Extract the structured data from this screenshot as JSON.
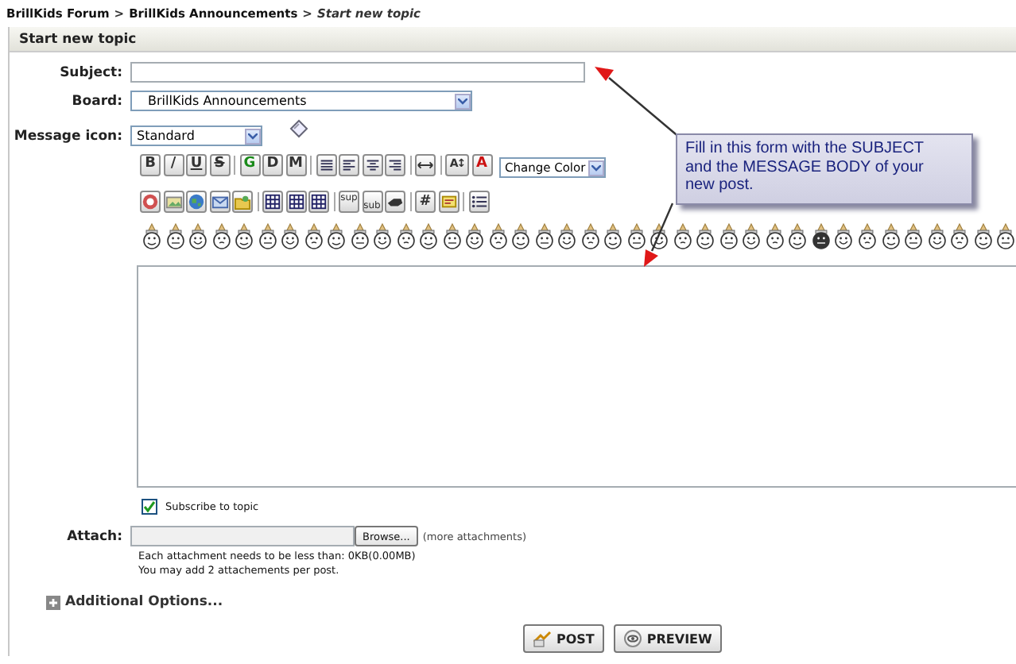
{
  "breadcrumb": [
    {
      "kind": "link",
      "text": "BrillKids Forum"
    },
    {
      "kind": "separator",
      "text": ">"
    },
    {
      "kind": "link",
      "text": "BrillKids Announcements"
    },
    {
      "kind": "separator",
      "text": ">"
    },
    {
      "kind": "current",
      "text": "Start new topic"
    }
  ],
  "panel": {
    "title": "Start new topic"
  },
  "subject": {
    "label": "Subject:"
  },
  "board": {
    "label": "Board:",
    "value": "BrillKids Announcements"
  },
  "message_icon": {
    "label": "Message icon:",
    "value": "Standard"
  },
  "toolbar": {
    "rows": [
      [
        [
          {
            "kind": "bold",
            "text": "B"
          },
          {
            "kind": "plain",
            "text": "/"
          },
          {
            "kind": "underline",
            "text": "U"
          },
          {
            "kind": "strike",
            "text": "S"
          }
        ],
        [
          {
            "kind": "bold",
            "text": "G",
            "color": "#1a8a1a"
          },
          {
            "kind": "bold",
            "text": "D"
          },
          {
            "kind": "bold",
            "text": "M"
          }
        ],
        [
          {
            "kind": "align-justify"
          },
          {
            "kind": "align-left"
          },
          {
            "kind": "align-center"
          },
          {
            "kind": "align-right"
          }
        ],
        [
          {
            "kind": "rule"
          }
        ],
        [
          {
            "kind": "bold",
            "text": "A↕"
          },
          {
            "kind": "bold",
            "text": "A",
            "color": "#cc1111"
          }
        ]
      ],
      [
        [
          {
            "kind": "flash"
          },
          {
            "kind": "image"
          },
          {
            "kind": "globe"
          },
          {
            "kind": "email"
          },
          {
            "kind": "folder"
          }
        ],
        [
          {
            "kind": "table"
          },
          {
            "kind": "table"
          },
          {
            "kind": "table"
          }
        ],
        [
          {
            "kind": "sup",
            "text": "sup"
          },
          {
            "kind": "sub",
            "text": "sub"
          },
          {
            "kind": "teletype"
          }
        ],
        [
          {
            "kind": "bold",
            "text": "#"
          },
          {
            "kind": "quote"
          }
        ],
        [
          {
            "kind": "list"
          }
        ]
      ]
    ]
  },
  "color_select": {
    "value": "Change Color"
  },
  "subscribe": {
    "label": "Subscribe to topic",
    "checked": true
  },
  "attach": {
    "label": "Attach:",
    "browse": "Browse...",
    "more_link": "(more attachments)",
    "notes": [
      "Each attachment needs to be less than: 0KB(0.00MB)",
      "You may add 2 attachements per post."
    ]
  },
  "additional_options": {
    "label": "Additional Options...",
    "expanded": false
  },
  "buttons": [
    {
      "kind": "post",
      "label": "POST"
    },
    {
      "kind": "preview",
      "label": "PREVIEW"
    }
  ],
  "callout": {
    "text": "Fill in this form with the SUBJECT and the MESSAGE BODY of your new post."
  }
}
